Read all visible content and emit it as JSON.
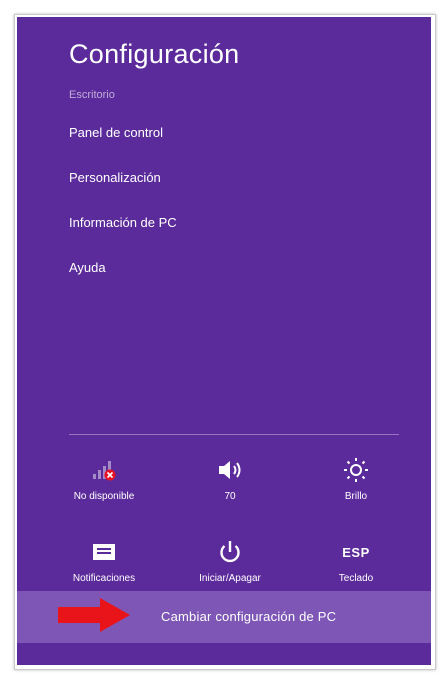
{
  "panel": {
    "title": "Configuración",
    "subtitle": "Escritorio",
    "items": [
      {
        "label": "Panel de control"
      },
      {
        "label": "Personalización"
      },
      {
        "label": "Información de PC"
      },
      {
        "label": "Ayuda"
      }
    ]
  },
  "quick_settings": {
    "network": {
      "label": "No disponible",
      "icon": "network-unavailable-icon"
    },
    "volume": {
      "label": "70",
      "icon": "speaker-icon"
    },
    "brightness": {
      "label": "Brillo",
      "icon": "sun-icon"
    },
    "notifications": {
      "label": "Notificaciones",
      "icon": "notifications-icon"
    },
    "power": {
      "label": "Iniciar/Apagar",
      "icon": "power-icon"
    },
    "keyboard": {
      "label": "Teclado",
      "icon_text": "ESP"
    }
  },
  "footer": {
    "change_settings_label": "Cambiar configuración de PC"
  },
  "colors": {
    "panel_background": "#5c2b9b",
    "footer_background": "#7d56b6",
    "arrow": "#e8141a",
    "error_badge": "#e81123"
  }
}
